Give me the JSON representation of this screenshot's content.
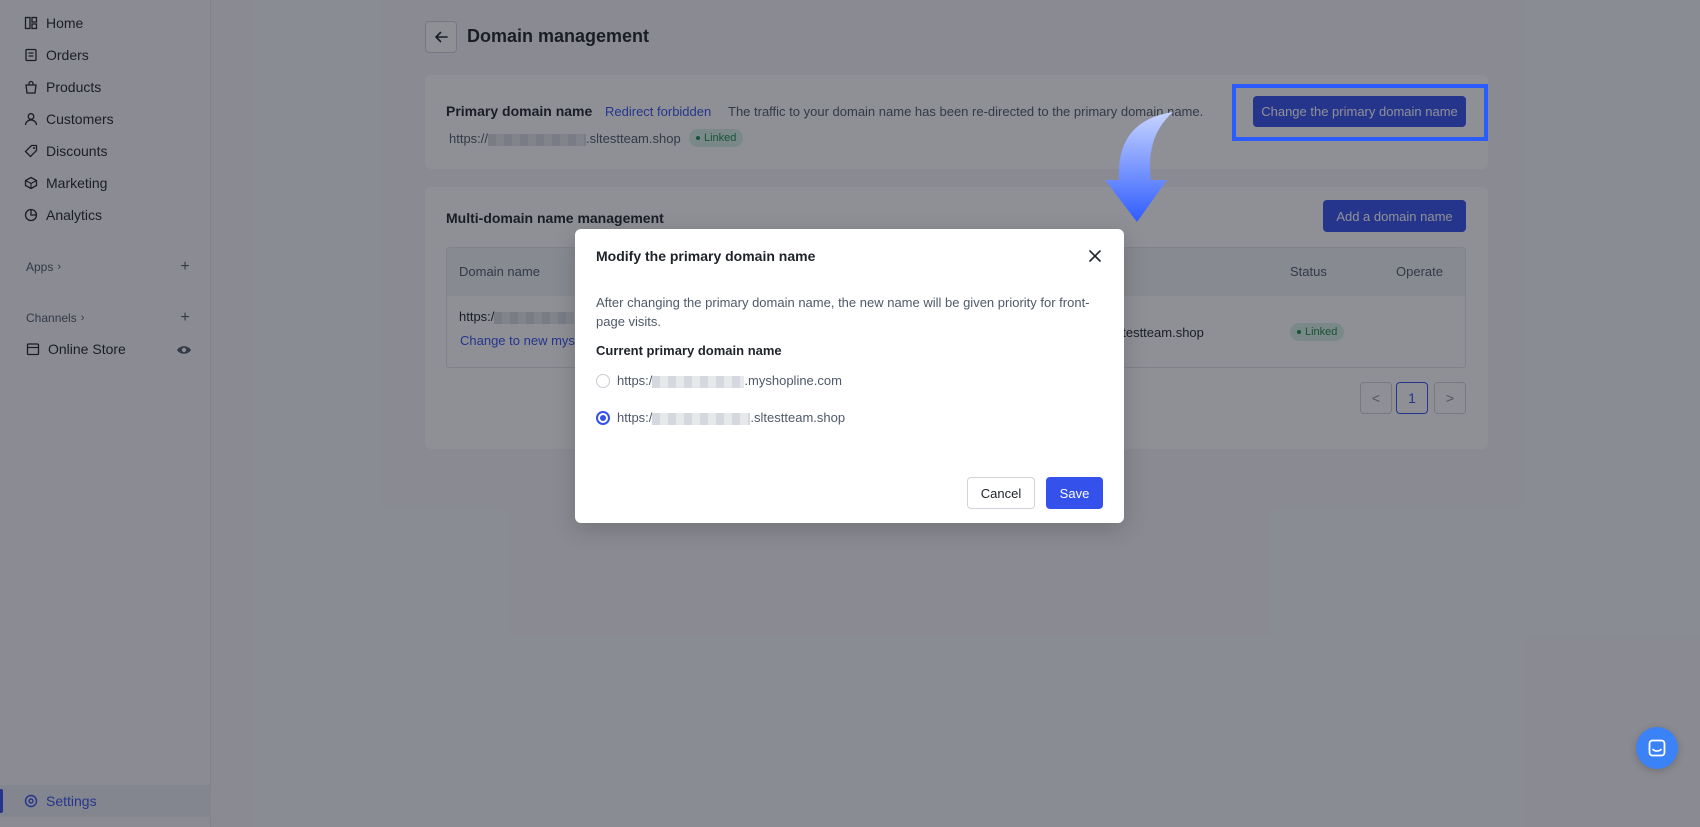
{
  "sidebar": {
    "items": [
      {
        "label": "Home",
        "icon": "home-icon"
      },
      {
        "label": "Orders",
        "icon": "orders-icon"
      },
      {
        "label": "Products",
        "icon": "products-icon"
      },
      {
        "label": "Customers",
        "icon": "customers-icon"
      },
      {
        "label": "Discounts",
        "icon": "discounts-icon"
      },
      {
        "label": "Marketing",
        "icon": "marketing-icon"
      },
      {
        "label": "Analytics",
        "icon": "analytics-icon"
      }
    ],
    "apps_label": "Apps",
    "channels_label": "Channels",
    "online_store_label": "Online Store",
    "settings_label": "Settings"
  },
  "header": {
    "title": "Domain management"
  },
  "primary_card": {
    "label": "Primary domain name",
    "redirect_link": "Redirect forbidden",
    "traffic_text": "The traffic to your domain name has been re-directed to the primary domain name.",
    "url_prefix": "https://",
    "url_suffix": ".sltestteam.shop",
    "status": "Linked",
    "change_button": "Change the primary domain name"
  },
  "multi_card": {
    "title": "Multi-domain name management",
    "add_button": "Add a domain name",
    "columns": [
      "Domain name",
      "Status",
      "Operate"
    ],
    "row": {
      "url_prefix": "https:/",
      "url_suffix": "q.sltestteam.shop",
      "link": "Change to new mys",
      "status": "Linked"
    },
    "pagination": {
      "current_page": "1",
      "prev": "<",
      "next": ">"
    }
  },
  "modal": {
    "title": "Modify the primary domain name",
    "description": "After changing the primary domain name, the new name will be given priority for front-page visits.",
    "current_label": "Current primary domain name",
    "options": [
      {
        "prefix": "https:/",
        "suffix": ".myshopline.com",
        "selected": false
      },
      {
        "prefix": "https:/",
        "suffix": ".sltestteam.shop",
        "selected": true
      }
    ],
    "cancel": "Cancel",
    "save": "Save"
  },
  "colors": {
    "accent": "#3451ec",
    "highlight": "#2a5bff",
    "linked_bg": "#d7f2e3"
  }
}
